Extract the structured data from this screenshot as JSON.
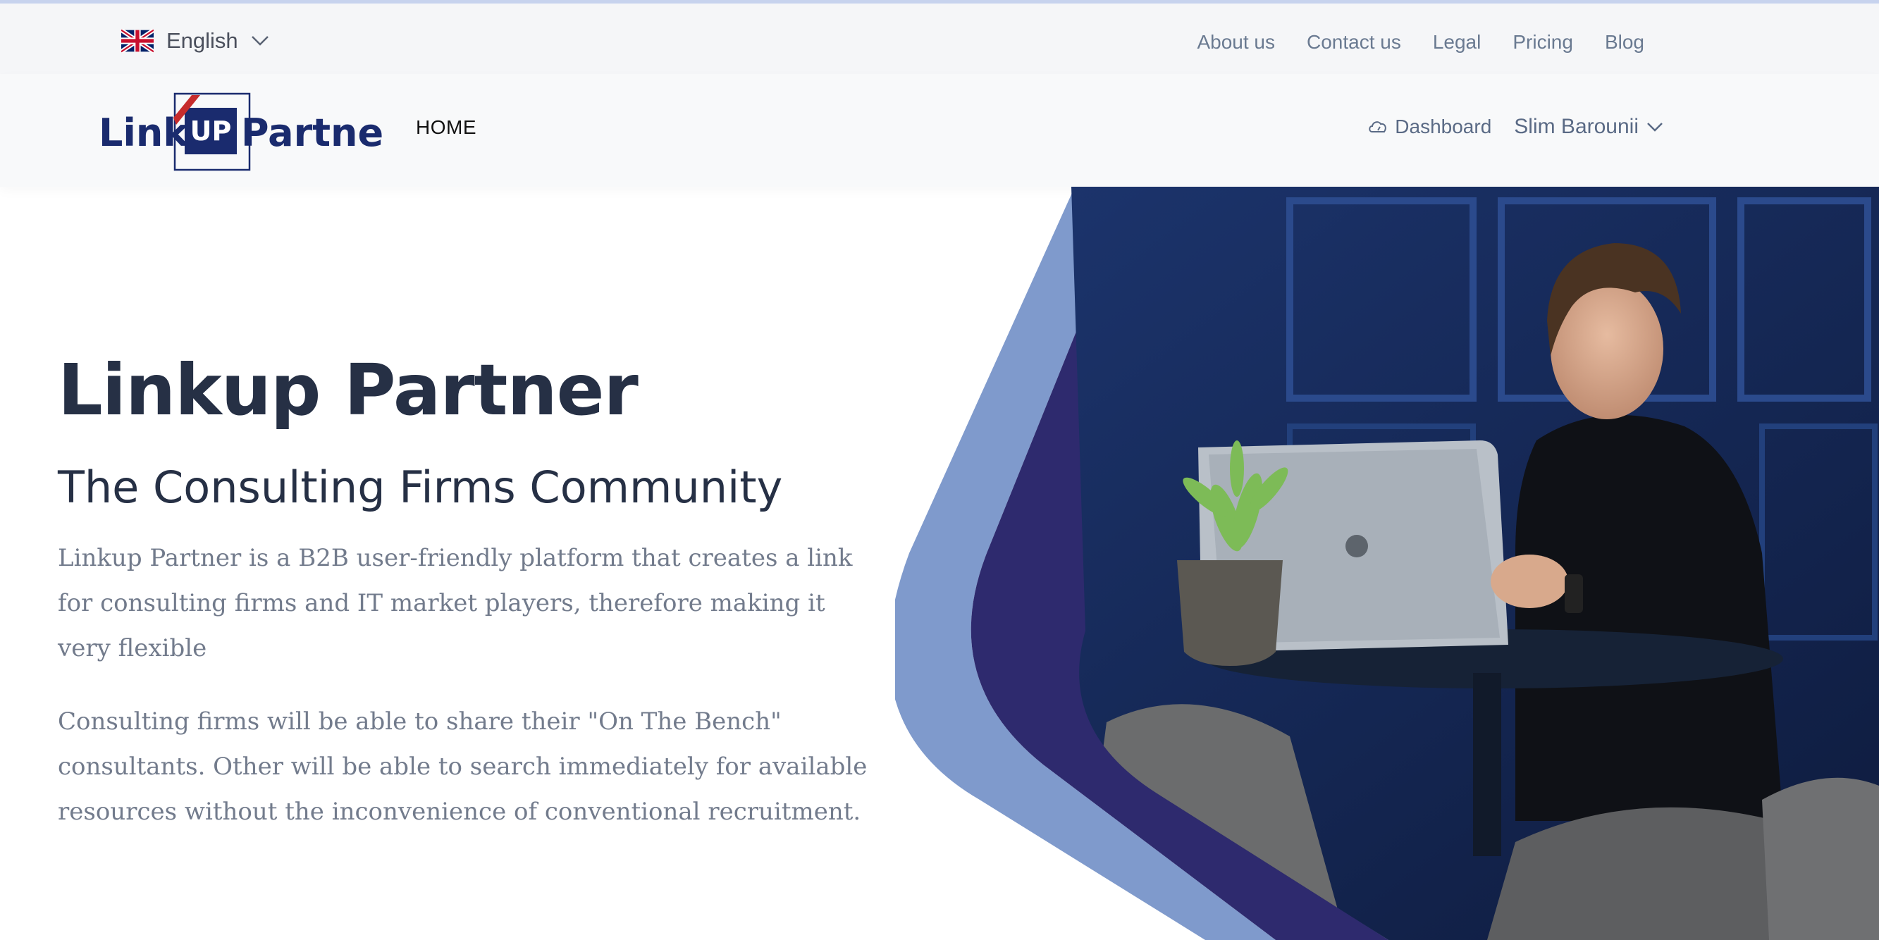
{
  "topbar": {
    "language": {
      "label": "English",
      "flag_icon": "uk-flag-icon",
      "chevron_icon": "chevron-down-icon"
    },
    "links": [
      "About us",
      "Contact us",
      "Legal",
      "Pricing",
      "Blog"
    ]
  },
  "navbar": {
    "logo_text": "LinkUpPartner",
    "home_label": "HOME",
    "dashboard_label": "Dashboard",
    "dashboard_icon": "cloud-gauge-icon",
    "user_name": "Slim Barounii",
    "user_chevron_icon": "chevron-down-icon"
  },
  "hero": {
    "title": "Linkup Partner",
    "subtitle": "The Consulting Firms Community",
    "paragraph1": "Linkup Partner is a B2B user-friendly platform that creates a link for consulting firms and IT market players, therefore making it very flexible",
    "paragraph2": "Consulting firms will be able to share their \"On The Bench\" consultants. Other will be able to search immediately for available resources without the inconvenience of conventional recruitment."
  },
  "colors": {
    "heading": "#263045",
    "body_text": "#727b8c",
    "link": "#6a7a91",
    "brand_navy": "#1a2b6e",
    "band_light": "#7f9acc",
    "band_dark": "#2e2a6e",
    "wall_blue": "#1c3166"
  }
}
